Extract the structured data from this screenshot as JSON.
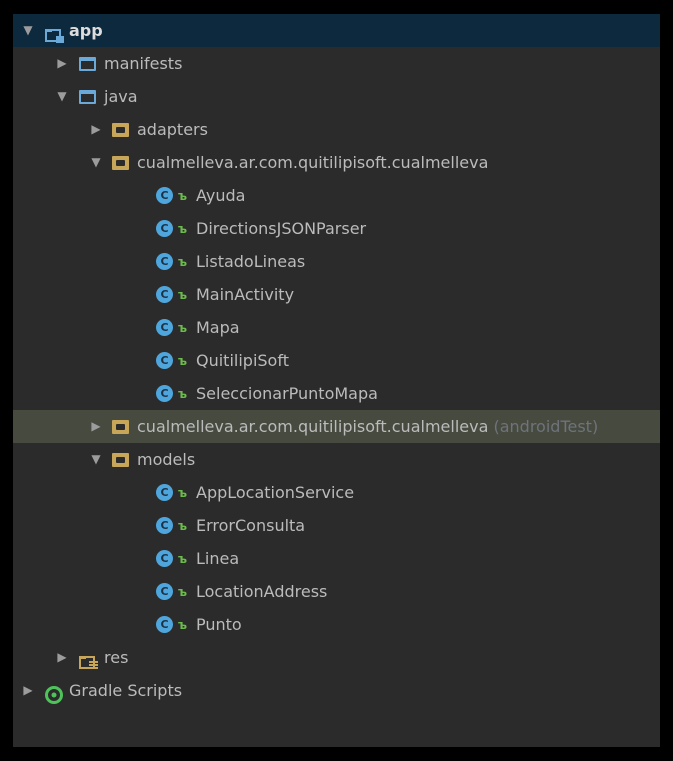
{
  "tree": {
    "app": {
      "label": "app",
      "expanded": true
    },
    "manifests": {
      "label": "manifests",
      "expanded": false
    },
    "java": {
      "label": "java",
      "expanded": true
    },
    "adapters": {
      "label": "adapters",
      "expanded": false
    },
    "pkg_main": {
      "label": "cualmelleva.ar.com.quitilipisoft.cualmelleva",
      "expanded": true
    },
    "pkg_main_classes": [
      "Ayuda",
      "DirectionsJSONParser",
      "ListadoLineas",
      "MainActivity",
      "Mapa",
      "QuitilipiSoft",
      "SeleccionarPuntoMapa"
    ],
    "pkg_test": {
      "label": "cualmelleva.ar.com.quitilipisoft.cualmelleva",
      "suffix": "(androidTest)",
      "expanded": false
    },
    "models": {
      "label": "models",
      "expanded": true
    },
    "models_classes": [
      "AppLocationService",
      "ErrorConsulta",
      "Linea",
      "LocationAddress",
      "Punto"
    ],
    "res": {
      "label": "res",
      "expanded": false
    },
    "gradle": {
      "label": "Gradle Scripts",
      "expanded": false
    }
  },
  "icons": {
    "expanded_arrow": "▼",
    "collapsed_arrow": "▶",
    "class_glyph": "C",
    "lock_glyph": "ъ"
  },
  "colors": {
    "background": "#2b2b2b",
    "selected_row": "#0d293e",
    "hover_row": "#464a3f",
    "class_icon": "#4ea6dd",
    "package_folder": "#c7a65a",
    "source_folder": "#6aa9d8"
  }
}
